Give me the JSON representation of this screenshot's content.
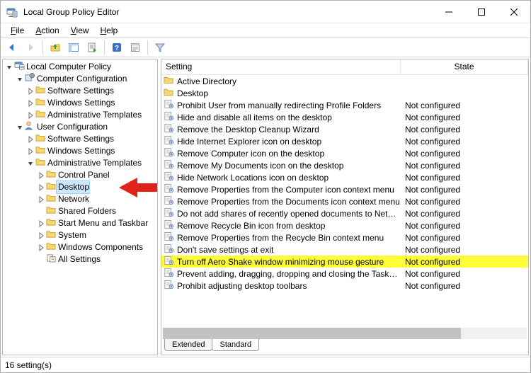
{
  "window": {
    "title": "Local Group Policy Editor"
  },
  "menubar": {
    "file": "File",
    "action": "Action",
    "view": "View",
    "help": "Help"
  },
  "tree": {
    "root": "Local Computer Policy",
    "nodes": [
      {
        "d": 0,
        "tw": "v",
        "icon": "root",
        "label": "Local Computer Policy"
      },
      {
        "d": 1,
        "tw": "v",
        "icon": "gear",
        "label": "Computer Configuration"
      },
      {
        "d": 2,
        "tw": ">",
        "icon": "folder",
        "label": "Software Settings"
      },
      {
        "d": 2,
        "tw": ">",
        "icon": "folder",
        "label": "Windows Settings"
      },
      {
        "d": 2,
        "tw": ">",
        "icon": "folder",
        "label": "Administrative Templates"
      },
      {
        "d": 1,
        "tw": "v",
        "icon": "user",
        "label": "User Configuration"
      },
      {
        "d": 2,
        "tw": ">",
        "icon": "folder",
        "label": "Software Settings"
      },
      {
        "d": 2,
        "tw": ">",
        "icon": "folder",
        "label": "Windows Settings"
      },
      {
        "d": 2,
        "tw": "v",
        "icon": "folder",
        "label": "Administrative Templates"
      },
      {
        "d": 3,
        "tw": ">",
        "icon": "folder",
        "label": "Control Panel"
      },
      {
        "d": 3,
        "tw": ">",
        "icon": "folder",
        "label": "Desktop",
        "selected": true,
        "arrow": true
      },
      {
        "d": 3,
        "tw": ">",
        "icon": "folder",
        "label": "Network"
      },
      {
        "d": 3,
        "tw": "",
        "icon": "folder",
        "label": "Shared Folders"
      },
      {
        "d": 3,
        "tw": ">",
        "icon": "folder",
        "label": "Start Menu and Taskbar"
      },
      {
        "d": 3,
        "tw": ">",
        "icon": "folder",
        "label": "System"
      },
      {
        "d": 3,
        "tw": ">",
        "icon": "folder",
        "label": "Windows Components"
      },
      {
        "d": 3,
        "tw": "",
        "icon": "settings",
        "label": "All Settings"
      }
    ]
  },
  "list": {
    "columns": {
      "setting": "Setting",
      "state": "State"
    },
    "rows": [
      {
        "type": "folder",
        "label": "Active Directory",
        "state": ""
      },
      {
        "type": "folder",
        "label": "Desktop",
        "state": ""
      },
      {
        "type": "policy",
        "label": "Prohibit User from manually redirecting Profile Folders",
        "state": "Not configured"
      },
      {
        "type": "policy",
        "label": "Hide and disable all items on the desktop",
        "state": "Not configured"
      },
      {
        "type": "policy",
        "label": "Remove the Desktop Cleanup Wizard",
        "state": "Not configured"
      },
      {
        "type": "policy",
        "label": "Hide Internet Explorer icon on desktop",
        "state": "Not configured"
      },
      {
        "type": "policy",
        "label": "Remove Computer icon on the desktop",
        "state": "Not configured"
      },
      {
        "type": "policy",
        "label": "Remove My Documents icon on the desktop",
        "state": "Not configured"
      },
      {
        "type": "policy",
        "label": "Hide Network Locations icon on desktop",
        "state": "Not configured"
      },
      {
        "type": "policy",
        "label": "Remove Properties from the Computer icon context menu",
        "state": "Not configured"
      },
      {
        "type": "policy",
        "label": "Remove Properties from the Documents icon context menu",
        "state": "Not configured"
      },
      {
        "type": "policy",
        "label": "Do not add shares of recently opened documents to Network...",
        "state": "Not configured"
      },
      {
        "type": "policy",
        "label": "Remove Recycle Bin icon from desktop",
        "state": "Not configured"
      },
      {
        "type": "policy",
        "label": "Remove Properties from the Recycle Bin context menu",
        "state": "Not configured"
      },
      {
        "type": "policy",
        "label": "Don't save settings at exit",
        "state": "Not configured"
      },
      {
        "type": "policy",
        "label": "Turn off Aero Shake window minimizing mouse gesture",
        "state": "Not configured",
        "highlight": true
      },
      {
        "type": "policy",
        "label": "Prevent adding, dragging, dropping and closing the Taskbar'...",
        "state": "Not configured"
      },
      {
        "type": "policy",
        "label": "Prohibit adjusting desktop toolbars",
        "state": "Not configured"
      }
    ]
  },
  "tabs": {
    "extended": "Extended",
    "standard": "Standard"
  },
  "statusbar": {
    "text": "16 setting(s)"
  }
}
